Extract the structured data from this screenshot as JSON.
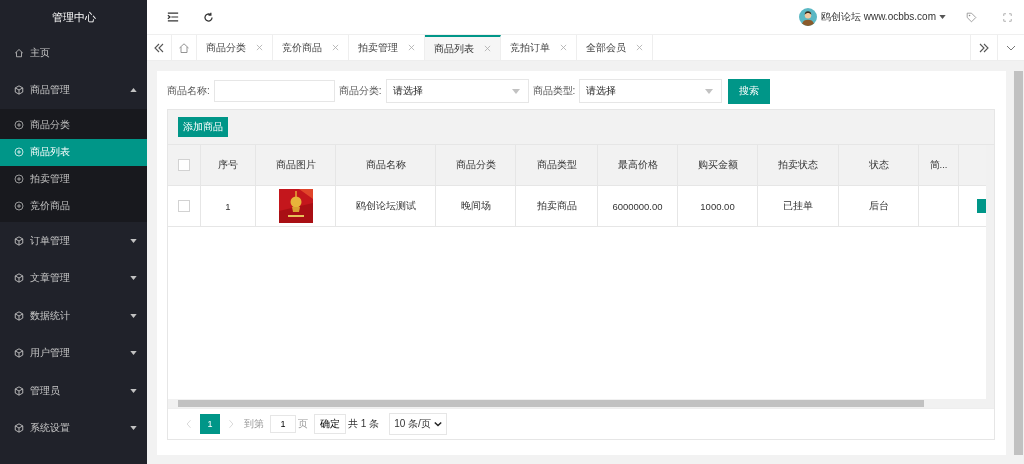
{
  "sidebar": {
    "title": "管理中心",
    "items": [
      {
        "label": "主页",
        "kind": "link"
      },
      {
        "label": "商品管理",
        "kind": "group",
        "expanded": true,
        "children": [
          {
            "label": "商品分类",
            "selected": false
          },
          {
            "label": "商品列表",
            "selected": true
          },
          {
            "label": "拍卖管理",
            "selected": false
          },
          {
            "label": "竞价商品",
            "selected": false
          }
        ]
      },
      {
        "label": "订单管理",
        "kind": "group",
        "expanded": false
      },
      {
        "label": "文章管理",
        "kind": "group",
        "expanded": false
      },
      {
        "label": "数据统计",
        "kind": "group",
        "expanded": false
      },
      {
        "label": "用户管理",
        "kind": "group",
        "expanded": false
      },
      {
        "label": "管理员",
        "kind": "group",
        "expanded": false
      },
      {
        "label": "系统设置",
        "kind": "group",
        "expanded": false
      }
    ]
  },
  "header": {
    "user": "鸥创论坛 www.ocbbs.com"
  },
  "tabs": [
    {
      "label": "商品分类",
      "selected": false
    },
    {
      "label": "竞价商品",
      "selected": false
    },
    {
      "label": "拍卖管理",
      "selected": false
    },
    {
      "label": "商品列表",
      "selected": true
    },
    {
      "label": "竞拍订单",
      "selected": false
    },
    {
      "label": "全部会员",
      "selected": false
    }
  ],
  "filters": [
    {
      "label": "商品名称:",
      "kind": "input"
    },
    {
      "label": "商品分类:",
      "kind": "select",
      "value": "请选择"
    },
    {
      "label": "商品类型:",
      "kind": "select",
      "value": "请选择"
    }
  ],
  "search_button": "搜索",
  "add_button": "添加商品",
  "table": {
    "header_checked": false,
    "columns": [
      "序号",
      "商品图片",
      "商品名称",
      "商品分类",
      "商品类型",
      "最高价格",
      "购买金额",
      "拍卖状态",
      "状态",
      "简..."
    ],
    "rows": [
      {
        "checked": false,
        "cells": [
          "1",
          "",
          "鸥创论坛测试",
          "晚间场",
          "拍卖商品",
          "6000000.00",
          "1000.00",
          "已挂单",
          "后台",
          ""
        ]
      }
    ]
  },
  "pagination": {
    "pages": [
      {
        "label": "1",
        "selected": true
      }
    ],
    "goto_label": "到第",
    "goto_value": "1",
    "page_unit": "页",
    "confirm": "确定",
    "total": "共 1 条",
    "page_size": "10 条/页"
  }
}
